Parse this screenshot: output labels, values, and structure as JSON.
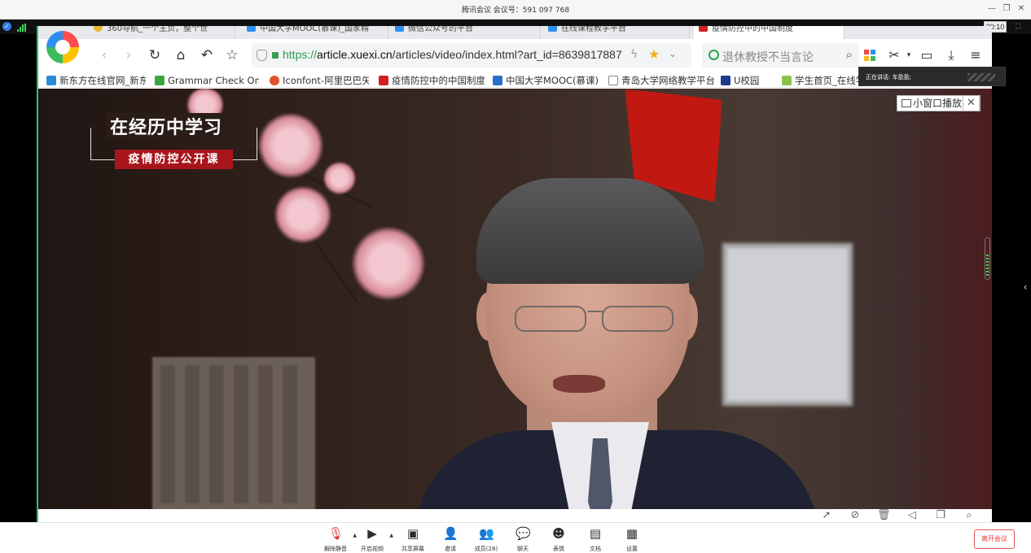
{
  "meeting": {
    "title": "腾讯会议 会议号：591 097 768",
    "timer": "30:10",
    "speaking": "正在讲话: 车盈盈;"
  },
  "browser": {
    "tabs": [
      {
        "label": "360导航_一个主页，整个世"
      },
      {
        "label": "中国大学MOOC(慕课)_国家精"
      },
      {
        "label": "微信公众号的平台"
      },
      {
        "label": "在线课程教学平台"
      },
      {
        "label": "疫情防控中的中国制度"
      }
    ],
    "url_scheme": "https://",
    "url_host": "article.xuexi.cn",
    "url_path": "/articles/video/index.html?art_id=8639817887",
    "search_placeholder": "退休教授不当言论",
    "bookmarks": [
      {
        "label": "新东方在线官网_新东"
      },
      {
        "label": "Grammar Check Onl"
      },
      {
        "label": "Iconfont-阿里巴巴矢"
      },
      {
        "label": "疫情防控中的中国制度"
      },
      {
        "label": "中国大学MOOC(慕课)"
      },
      {
        "label": "青岛大学网络教学平台"
      },
      {
        "label": "U校园"
      },
      {
        "label": "学生首页_在线学堂"
      }
    ]
  },
  "video": {
    "title": "在经历中学习",
    "subtitle": "疫情防控公开课",
    "pip_label": "小窗口播放"
  },
  "toolbar": {
    "items": [
      {
        "label": "解除静音",
        "icon": "mic-muted-icon"
      },
      {
        "label": "开启视频",
        "icon": "video-off-icon"
      },
      {
        "label": "共享屏幕",
        "icon": "screen-share-icon"
      },
      {
        "label": "邀请",
        "icon": "invite-icon"
      },
      {
        "label": "成员(28)",
        "icon": "members-icon"
      },
      {
        "label": "聊天",
        "icon": "chat-icon"
      },
      {
        "label": "表情",
        "icon": "emoji-icon"
      },
      {
        "label": "文档",
        "icon": "document-icon"
      },
      {
        "label": "设置",
        "icon": "settings-icon"
      }
    ],
    "leave_label": "离开会议"
  },
  "colors": {
    "accent_green": "#27c86b",
    "leave_red": "#e03c36",
    "badge_red": "#a8151c",
    "https_green": "#2b9a4b"
  }
}
